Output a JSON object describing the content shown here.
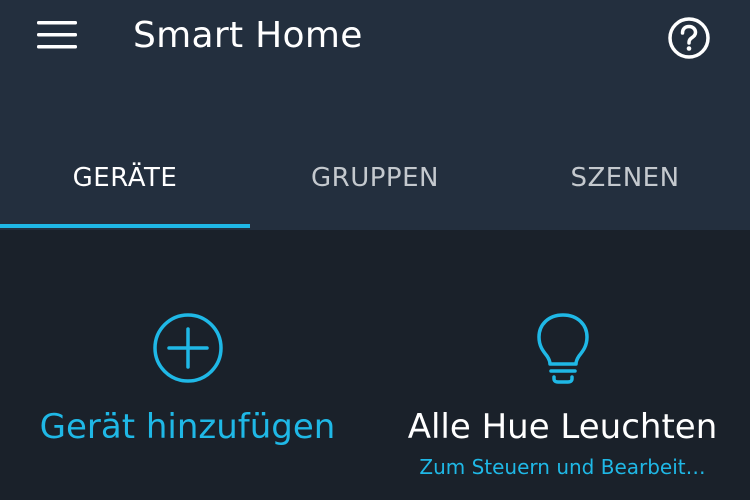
{
  "header": {
    "menu_icon": "hamburger-menu-icon",
    "title": "Smart Home",
    "help_icon": "help-circle-icon"
  },
  "tabs": [
    {
      "label": "GERÄTE",
      "active": true
    },
    {
      "label": "GRUPPEN",
      "active": false
    },
    {
      "label": "SZENEN",
      "active": false
    }
  ],
  "tiles": {
    "add_device": {
      "icon": "plus-circle-icon",
      "label": "Gerät hinzufügen"
    },
    "hue_group": {
      "icon": "light-bulb-icon",
      "label": "Alle Hue Leuchten",
      "subtitle": "Zum Steuern und Bearbeit…"
    }
  },
  "colors": {
    "accent": "#1fb8e6",
    "header_bg": "#232f3e",
    "content_bg": "#1a212a",
    "text_primary": "#ffffff",
    "text_inactive": "#c4c9ce"
  }
}
